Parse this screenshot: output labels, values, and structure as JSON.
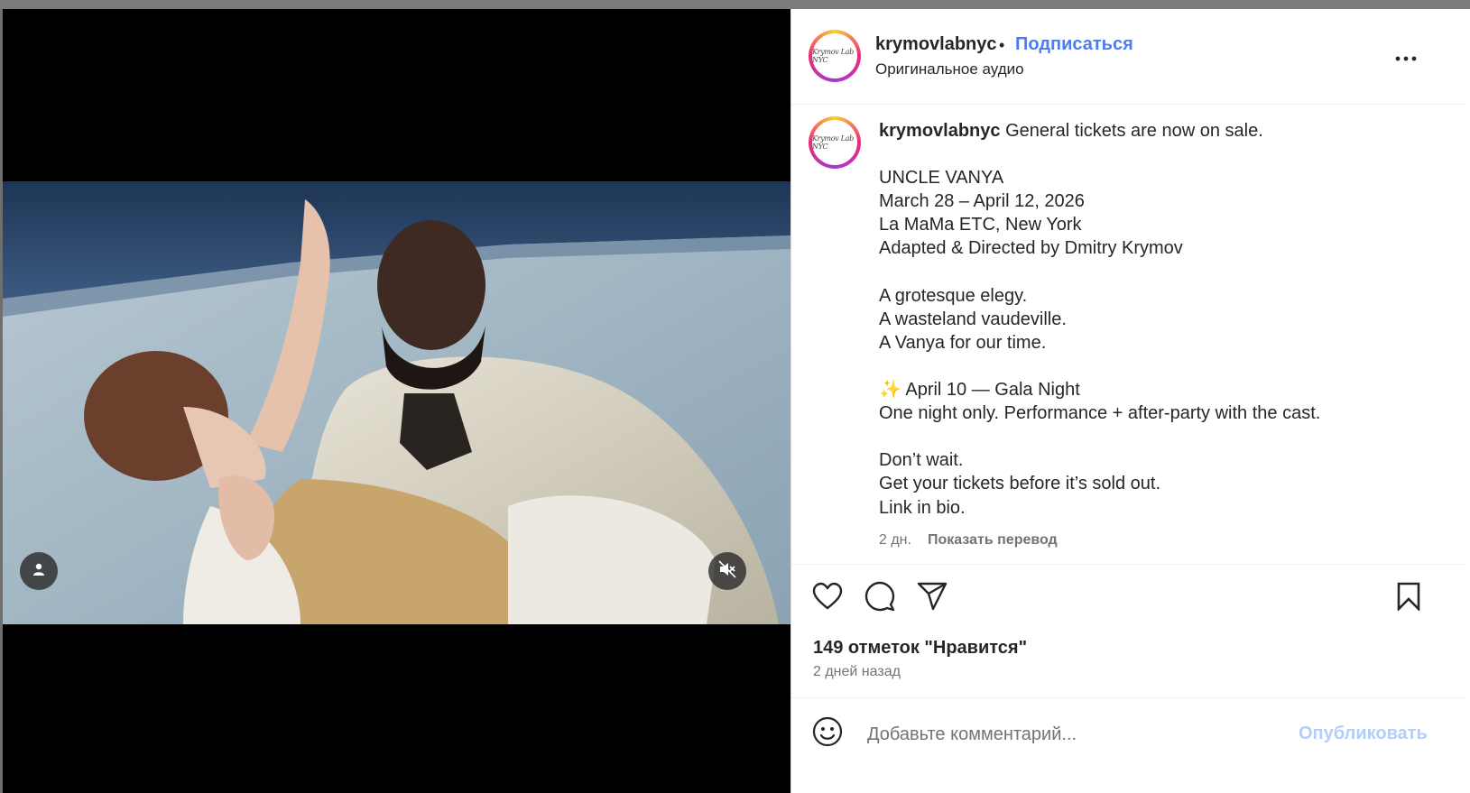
{
  "post": {
    "username": "krymovlabnyc",
    "avatar_text": "Krymov Lab NYC",
    "separator": "•",
    "follow_label": "Подписаться",
    "audio_label": "Оригинальное аудио",
    "more_icon": "more-horizontal-icon",
    "caption": {
      "username": "krymovlabnyc",
      "first_line": " General tickets are now on sale.",
      "lines": [
        "",
        "UNCLE VANYA",
        "March 28 – April 12, 2026",
        "La MaMa ETC, New York",
        "Adapted & Directed by Dmitry Krymov",
        "",
        "A grotesque elegy.",
        "A wasteland vaudeville.",
        "A Vanya for our time.",
        "",
        "✨ April 10 — Gala Night",
        "One night only. Performance + after-party with the cast.",
        "",
        "Don’t wait.",
        "Get your tickets before it’s sold out.",
        "Link in bio."
      ]
    },
    "caption_time": "2 дн.",
    "show_translation": "Показать перевод",
    "likes": "149 отметок \"Нравится\"",
    "posted_ago": "2 дней назад",
    "comment_placeholder": "Добавьте комментарий...",
    "publish_label": "Опубликовать",
    "video_icons": [
      "user-tag-icon",
      "muted-speaker-icon"
    ],
    "action_icons": [
      "heart-icon",
      "comment-icon",
      "share-icon",
      "bookmark-icon"
    ],
    "colors": {
      "link_blue": "#4a7cf3",
      "publish_disabled": "#b2cffa",
      "text": "#262626",
      "secondary": "#737373"
    }
  }
}
